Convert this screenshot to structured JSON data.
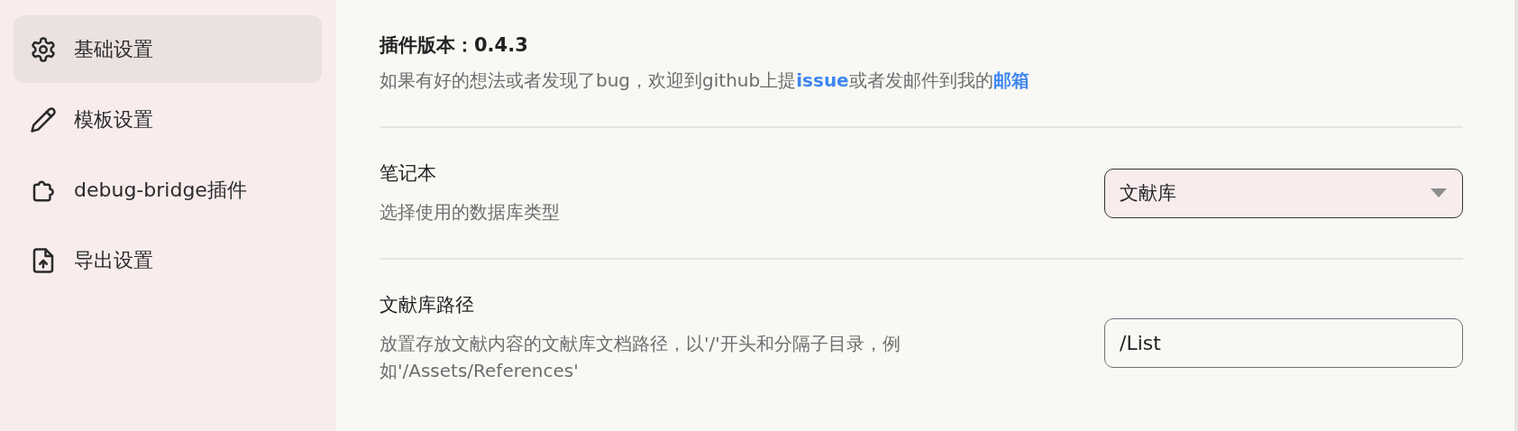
{
  "sidebar": {
    "items": [
      {
        "label": "基础设置",
        "selected": true
      },
      {
        "label": "模板设置",
        "selected": false
      },
      {
        "label": "debug-bridge插件",
        "selected": false
      },
      {
        "label": "导出设置",
        "selected": false
      }
    ]
  },
  "header": {
    "title": "插件版本：0.4.3",
    "description": [
      {
        "kind": "text",
        "text": "如果有好的想法或者发现了bug，欢迎到github上提"
      },
      {
        "kind": "link",
        "text": "issue"
      },
      {
        "kind": "text",
        "text": "或者发邮件到我的"
      },
      {
        "kind": "link",
        "text": "邮箱"
      }
    ]
  },
  "settings": [
    {
      "kind": "select",
      "label": "笔记本",
      "description": "选择使用的数据库类型",
      "value": "文献库"
    },
    {
      "kind": "input",
      "label": "文献库路径",
      "description": "放置存放文献内容的文献库文档路径，以'/'开头和分隔子目录，例如'/Assets/References'",
      "value": "/List"
    }
  ]
}
